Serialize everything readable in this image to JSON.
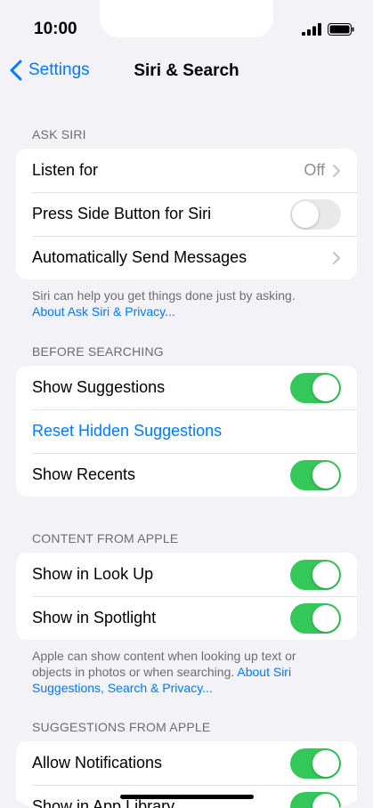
{
  "status": {
    "time": "10:00"
  },
  "nav": {
    "back_label": "Settings",
    "title": "Siri & Search"
  },
  "ask_siri": {
    "header": "ASK SIRI",
    "rows": [
      {
        "label": "Listen for",
        "value": "Off"
      },
      {
        "label": "Press Side Button for Siri",
        "toggle": "off"
      },
      {
        "label": "Automatically Send Messages"
      }
    ],
    "footer_text": "Siri can help you get things done just by asking.",
    "footer_link": "About Ask Siri & Privacy..."
  },
  "before_searching": {
    "header": "BEFORE SEARCHING",
    "rows": [
      {
        "label": "Show Suggestions",
        "toggle": "on"
      },
      {
        "label": "Reset Hidden Suggestions"
      },
      {
        "label": "Show Recents",
        "toggle": "on"
      }
    ]
  },
  "content_from_apple": {
    "header": "CONTENT FROM APPLE",
    "rows": [
      {
        "label": "Show in Look Up",
        "toggle": "on"
      },
      {
        "label": "Show in Spotlight",
        "toggle": "on"
      }
    ],
    "footer_text": "Apple can show content when looking up text or objects in photos or when searching. ",
    "footer_link": "About Siri Suggestions, Search & Privacy..."
  },
  "suggestions_from_apple": {
    "header": "SUGGESTIONS FROM APPLE",
    "rows": [
      {
        "label": "Allow Notifications",
        "toggle": "on"
      },
      {
        "label": "Show in App Library",
        "toggle": "on"
      }
    ]
  },
  "colors": {
    "accent": "#007aff",
    "toggle_on": "#34c759",
    "background": "#f2f2f7"
  }
}
